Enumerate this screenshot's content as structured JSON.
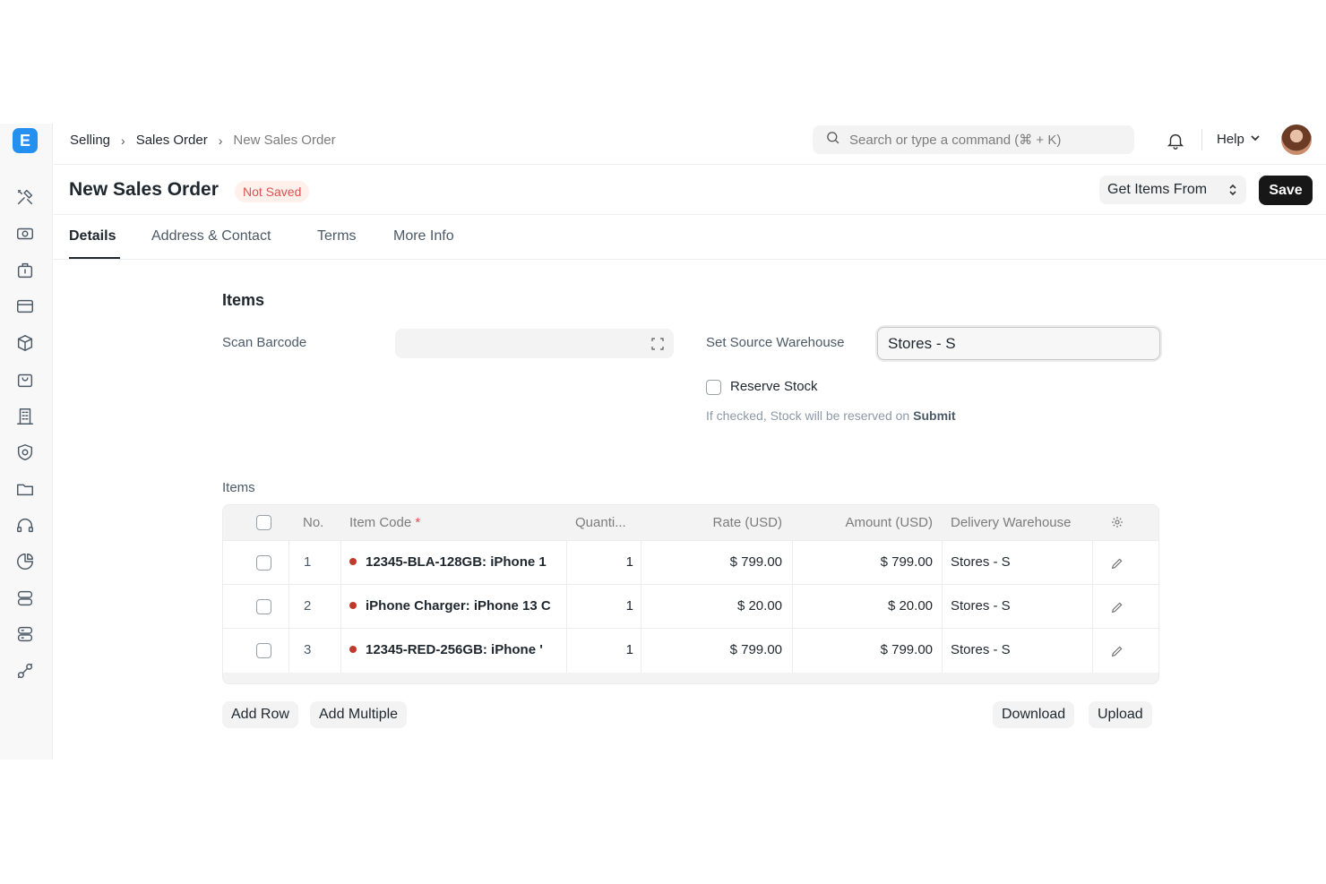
{
  "app": {
    "logo_letter": "E"
  },
  "breadcrumbs": [
    {
      "label": "Selling"
    },
    {
      "label": "Sales Order"
    },
    {
      "label": "New Sales Order"
    }
  ],
  "search": {
    "placeholder": "Search or type a command (⌘ + K)"
  },
  "header": {
    "help_label": "Help"
  },
  "page": {
    "title": "New Sales Order",
    "status": "Not Saved",
    "get_items_label": "Get Items From",
    "save_label": "Save"
  },
  "tabs": [
    {
      "label": "Details",
      "active": true
    },
    {
      "label": "Address & Contact"
    },
    {
      "label": "Terms"
    },
    {
      "label": "More Info"
    }
  ],
  "form": {
    "section_title": "Items",
    "scan_barcode_label": "Scan Barcode",
    "scan_barcode_value": "",
    "source_warehouse_label": "Set Source Warehouse",
    "source_warehouse_value": "Stores - S",
    "reserve_stock_label": "Reserve Stock",
    "reserve_stock_checked": false,
    "reserve_hint_prefix": "If checked, Stock will be reserved on",
    "reserve_hint_bold": "Submit"
  },
  "items_table": {
    "label": "Items",
    "columns": {
      "no": "No.",
      "item_code": "Item Code",
      "required_mark": "*",
      "quantity": "Quanti...",
      "rate": "Rate (USD)",
      "amount": "Amount (USD)",
      "warehouse": "Delivery Warehouse"
    },
    "rows": [
      {
        "no": "1",
        "item_code": "12345-BLA-128GB: iPhone 1",
        "qty": "1",
        "rate": "$ 799.00",
        "amount": "$ 799.00",
        "warehouse": "Stores - S"
      },
      {
        "no": "2",
        "item_code": "iPhone Charger: iPhone 13 C",
        "qty": "1",
        "rate": "$ 20.00",
        "amount": "$ 20.00",
        "warehouse": "Stores - S"
      },
      {
        "no": "3",
        "item_code": "12345-RED-256GB: iPhone '",
        "qty": "1",
        "rate": "$ 799.00",
        "amount": "$ 799.00",
        "warehouse": "Stores - S"
      }
    ],
    "add_row_label": "Add Row",
    "add_multiple_label": "Add Multiple",
    "download_label": "Download",
    "upload_label": "Upload"
  },
  "colors": {
    "primary_dark": "#171717",
    "logo_blue": "#2490ef",
    "status_red": "#d9534f",
    "item_dot": "#c0392b"
  }
}
